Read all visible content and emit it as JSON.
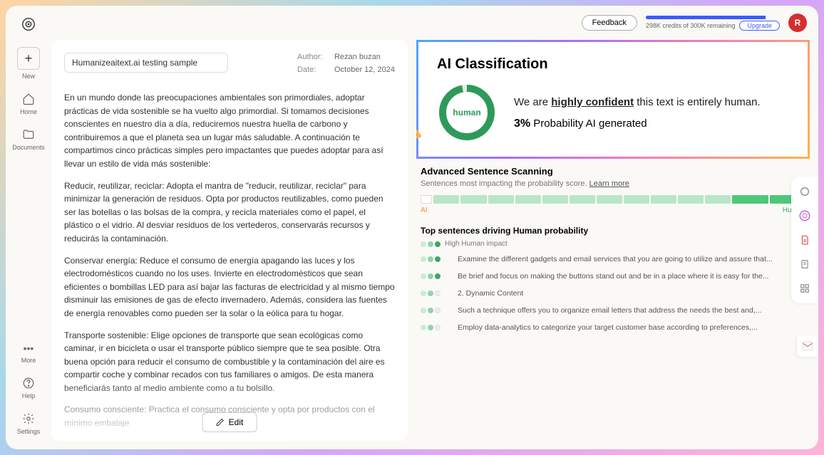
{
  "sidebar": {
    "new": "New",
    "home": "Home",
    "documents": "Documents",
    "more": "More",
    "help": "Help",
    "settings": "Settings"
  },
  "topbar": {
    "feedback": "Feedback",
    "credits_used_pct": 99,
    "credits_text": "298K credits of 300K remaining",
    "upgrade": "Upgrade",
    "avatar_initial": "R"
  },
  "document": {
    "title": "Humanizeaitext.ai testing sample",
    "author_label": "Author:",
    "author": "Rezan buzan",
    "date_label": "Date:",
    "date": "October 12, 2024",
    "paragraphs": [
      "En un mundo donde las preocupaciones ambientales son primordiales, adoptar prácticas de vida sostenible se ha vuelto algo primordial. Si tomamos decisiones conscientes en nuestro día a día, reduciremos nuestra huella de carbono y contribuiremos a que el planeta sea un lugar más saludable. A continuación te compartimos cinco prácticas simples pero impactantes que puedes adoptar para así llevar un estilo de vida más sostenible:",
      "Reducir, reutilizar, reciclar: Adopta el mantra de \"reducir, reutilizar, reciclar\" para minimizar la generación de residuos. Opta por productos reutilizables, como pueden ser las botellas o las bolsas de la compra, y recicla materiales como el papel, el plástico o el vidrio. Al desviar residuos de los vertederos, conservarás recursos y reducirás la contaminación.",
      "Conservar energía: Reduce el consumo de energía apagando las luces y los electrodomésticos cuando no los uses. Invierte en electrodomésticos que sean eficientes o bombillas LED para así bajar las facturas de electricidad y al mismo tiempo disminuir las emisiones de gas de efecto invernadero. Además, considera las fuentes de energía renovables como pueden ser la solar o la eólica para tu hogar.",
      "Transporte sostenible: Elige opciones de transporte que sean ecológicas como caminar, ir en bicicleta o usar el transporte público siempre que te sea posible. Otra buena opción para reducir el consumo de combustible y la contaminación del aire es compartir coche y combinar recados con tus familiares o amigos. De esta manera beneficiarás tanto al medio ambiente como a tu bolsillo.",
      "Consumo consciente: Practica el consumo consciente y opta por productos con el mínimo embalaje"
    ],
    "edit": "Edit"
  },
  "classification": {
    "title": "AI Classification",
    "donut_label": "human",
    "donut_human_pct": 97,
    "conf_prefix": "We are ",
    "conf_highlight": "highly confident",
    "conf_suffix": " this text is entirely human.",
    "prob_value": "3%",
    "prob_label": " Probability AI generated"
  },
  "scanning": {
    "title": "Advanced Sentence Scanning",
    "subtitle": "Sentences most impacting the probability score. ",
    "learn_more": "Learn more",
    "legend_ai": "AI",
    "legend_human": "Human",
    "segments": [
      "ai",
      "mid",
      "mid",
      "mid",
      "mid",
      "mid",
      "mid",
      "mid",
      "mid",
      "mid",
      "mid",
      "mid",
      "human",
      "human"
    ]
  },
  "top_sentences": {
    "title": "Top sentences driving Human probability",
    "impact_label": "High Human impact",
    "rows": [
      {
        "impact": 3,
        "text": "Examine the different gadgets and email services that you are going to utilize and assure that..."
      },
      {
        "impact": 3,
        "text": "Be brief and focus on making the buttons stand out and be in a place where it is easy for the..."
      },
      {
        "impact": 2,
        "text": "2. Dynamic Content"
      },
      {
        "impact": 2,
        "text": "Such a technique offers you to organize email letters that address the needs the best and,..."
      },
      {
        "impact": 2,
        "text": "Employ data-analytics to categorize your target customer base according to preferences,..."
      }
    ]
  }
}
